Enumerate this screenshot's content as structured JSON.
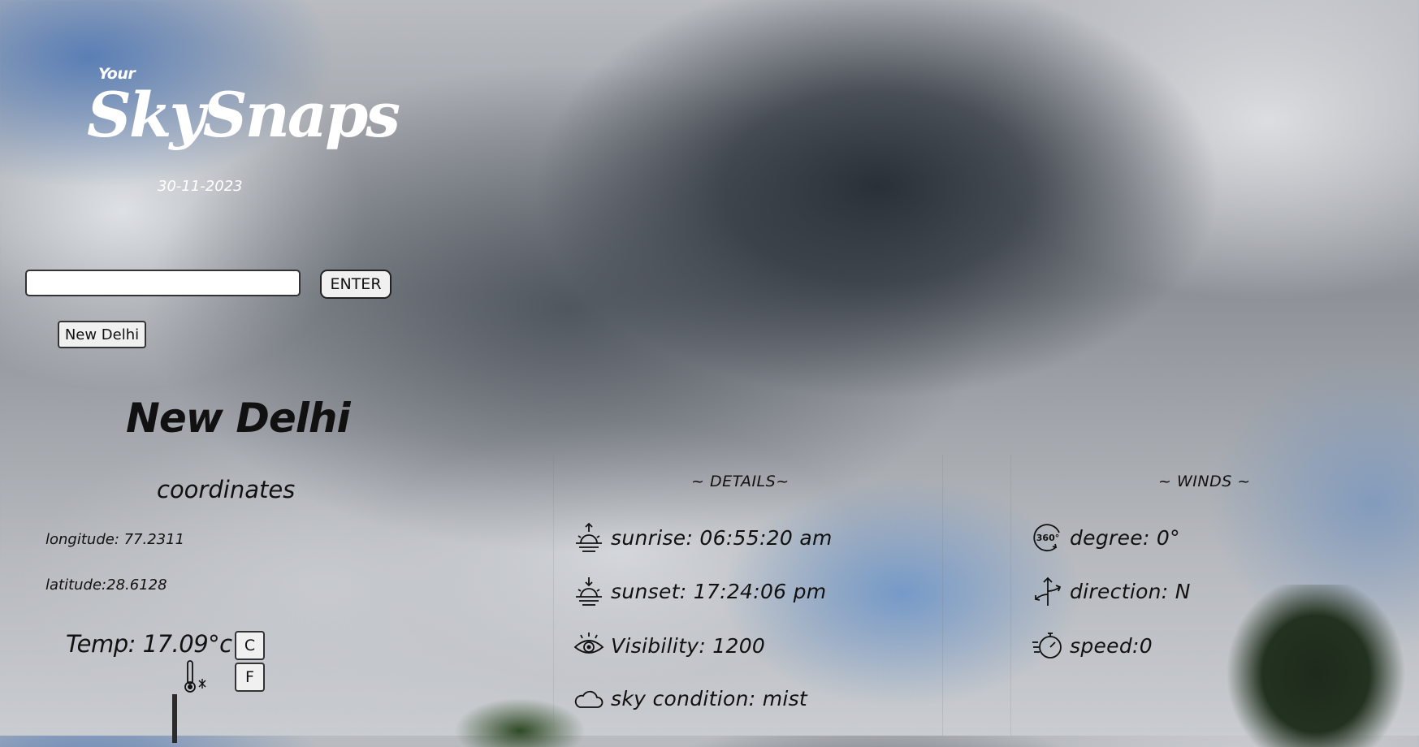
{
  "brand": {
    "prefix": "Your",
    "name": "SkySnaps",
    "date": "30-11-2023"
  },
  "search": {
    "value": "",
    "placeholder": "",
    "button_label": "ENTER"
  },
  "recent": [
    "New Delhi"
  ],
  "location": {
    "city": "New Delhi",
    "coordinates_title": "coordinates",
    "longitude": "longitude: 77.2311",
    "latitude": "latitude:28.6128"
  },
  "temperature": {
    "text": "Temp: 17.09°c",
    "celsius_label": "C",
    "fahrenheit_label": "F"
  },
  "details": {
    "title": "~ DETAILS~",
    "sunrise": "sunrise: 06:55:20 am",
    "sunset": "sunset: 17:24:06 pm",
    "visibility": "Visibility: 1200",
    "sky": "sky condition: mist"
  },
  "winds": {
    "title": "~ WINDS ~",
    "degree": "degree: 0°",
    "direction": "direction: N",
    "speed": "speed:0"
  },
  "icons": {
    "sunrise": "sunrise-icon",
    "sunset": "sunset-icon",
    "visibility": "eye-icon",
    "sky": "cloud-icon",
    "degree": "360-degree-icon",
    "direction": "direction-arrows-icon",
    "speed": "speedometer-icon",
    "thermometer": "thermometer-icon"
  }
}
